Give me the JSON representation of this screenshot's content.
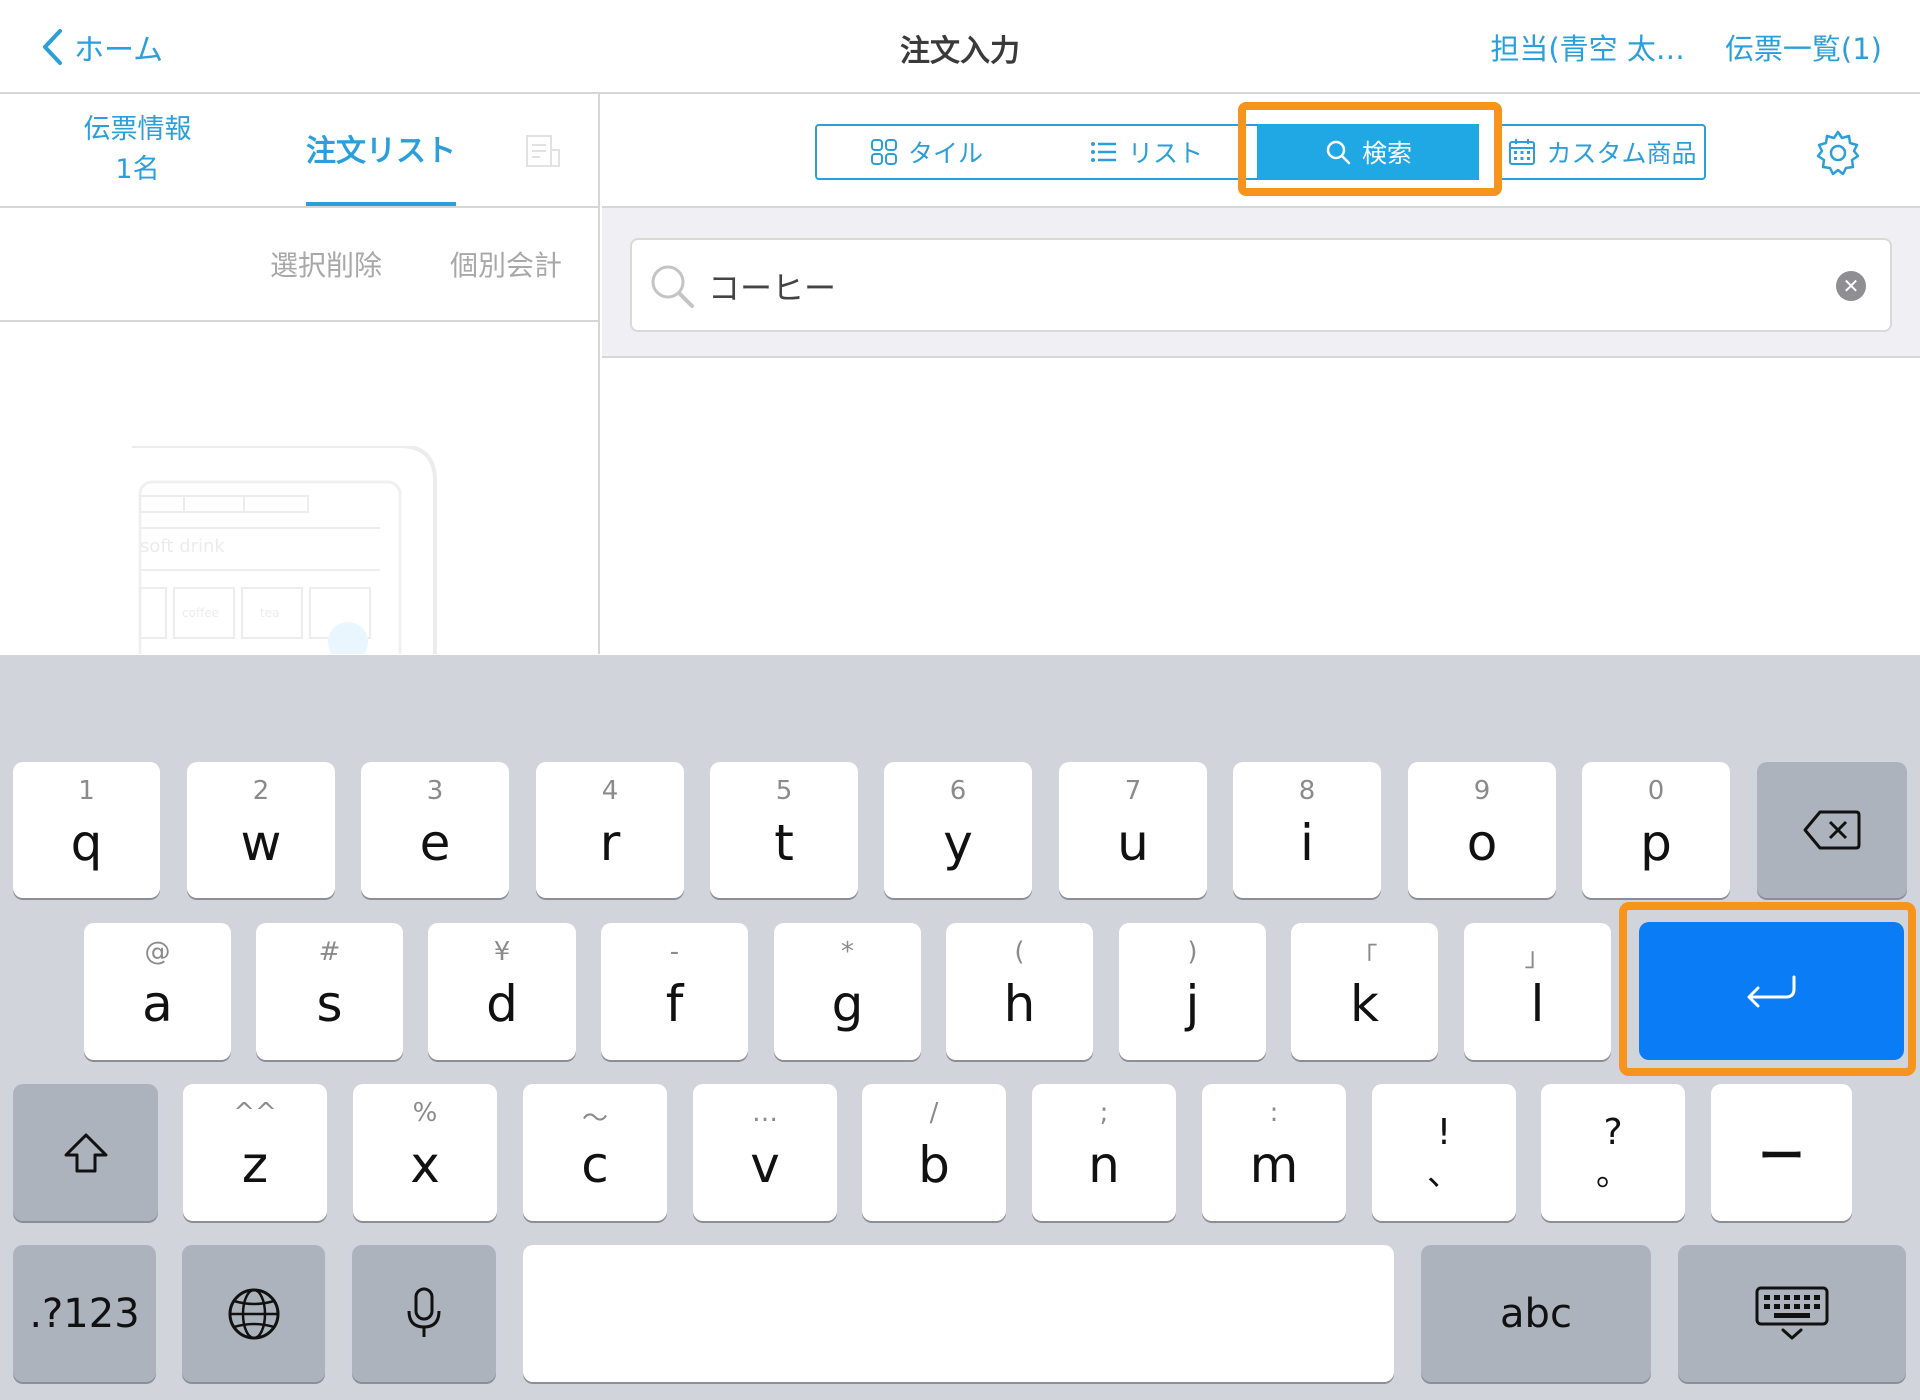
{
  "nav": {
    "back_label": "ホーム",
    "title": "注文入力",
    "staff": "担当(青空 太…",
    "slips": "伝票一覧(1)"
  },
  "left": {
    "tab_slip_line1": "伝票情報",
    "tab_slip_line2": "1名",
    "tab_order": "注文リスト",
    "delete_selected": "選択削除",
    "separate_checkout": "個別会計",
    "illustration_text": "soft drink",
    "illustration_items": [
      "coffee",
      "tea"
    ]
  },
  "right": {
    "seg_tile": "タイル",
    "seg_list": "リスト",
    "seg_search": "検索",
    "seg_custom": "カスタム商品",
    "search_value": "コーヒー"
  },
  "keyboard": {
    "row1": [
      {
        "sub": "1",
        "main": "q"
      },
      {
        "sub": "2",
        "main": "w"
      },
      {
        "sub": "3",
        "main": "e"
      },
      {
        "sub": "4",
        "main": "r"
      },
      {
        "sub": "5",
        "main": "t"
      },
      {
        "sub": "6",
        "main": "y"
      },
      {
        "sub": "7",
        "main": "u"
      },
      {
        "sub": "8",
        "main": "i"
      },
      {
        "sub": "9",
        "main": "o"
      },
      {
        "sub": "0",
        "main": "p"
      }
    ],
    "row2": [
      {
        "sub": "@",
        "main": "a"
      },
      {
        "sub": "#",
        "main": "s"
      },
      {
        "sub": "¥",
        "main": "d"
      },
      {
        "sub": "-",
        "main": "f"
      },
      {
        "sub": "*",
        "main": "g"
      },
      {
        "sub": "(",
        "main": "h"
      },
      {
        "sub": ")",
        "main": "j"
      },
      {
        "sub": "「",
        "main": "k"
      },
      {
        "sub": "」",
        "main": "l"
      }
    ],
    "row3": [
      {
        "sub": "^^",
        "main": "z"
      },
      {
        "sub": "%",
        "main": "x"
      },
      {
        "sub": "〜",
        "main": "c"
      },
      {
        "sub": "…",
        "main": "v"
      },
      {
        "sub": "/",
        "main": "b"
      },
      {
        "sub": ";",
        "main": "n"
      },
      {
        "sub": ":",
        "main": "m"
      },
      {
        "sub": "!",
        "main": "、"
      },
      {
        "sub": "?",
        "main": "。"
      },
      {
        "sub": "",
        "main": "ー"
      }
    ],
    "numbers_key": ".?123",
    "abc_key": "abc"
  },
  "colors": {
    "accent": "#2b9fd9",
    "highlight": "#f7941d",
    "enter_key": "#0a7cf5"
  }
}
